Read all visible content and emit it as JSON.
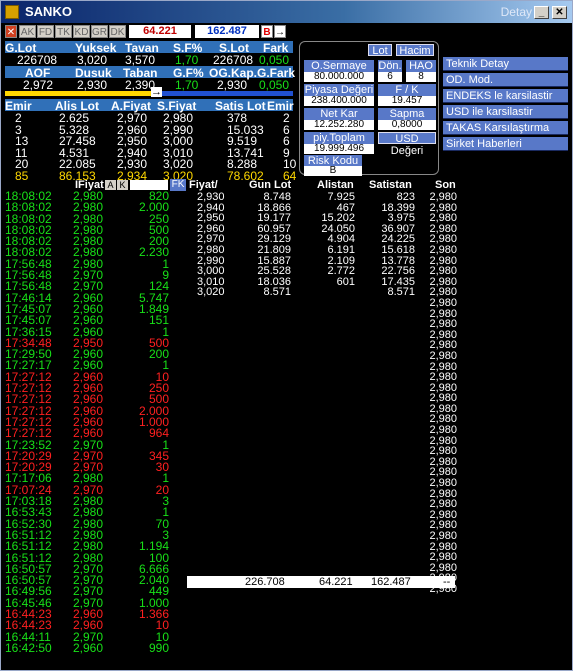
{
  "window": {
    "title": "SANKO",
    "detay": "Detay"
  },
  "toolbar": {
    "buttons": [
      "AK",
      "FD",
      "TK",
      "KD",
      "GR",
      "DK"
    ],
    "value1": "64.221",
    "value2": "162.487",
    "b_label": "B"
  },
  "summary": {
    "headers1": [
      "G.Lot",
      "Yuksek",
      "Tavan",
      "S.F%",
      "S.Lot",
      "Fark"
    ],
    "values1": [
      "226708",
      "3,020",
      "3,570",
      "1,70",
      "226708",
      "0,050"
    ],
    "headers2": [
      "AOF",
      "Dusuk",
      "Taban",
      "G.F%",
      "OG.Kap.",
      "G.Fark"
    ],
    "values2": [
      "2,972",
      "2,930",
      "2,390",
      "1,70",
      "2,930",
      "0,050"
    ]
  },
  "depth": {
    "headers": [
      "Emir",
      "Alis Lot",
      "A.Fiyat",
      "S.Fiyat",
      "Satis Lot",
      "Emir"
    ],
    "rows": [
      [
        "2",
        "2.625",
        "2,970",
        "2,980",
        "378",
        "2"
      ],
      [
        "3",
        "5.328",
        "2,960",
        "2,990",
        "15.033",
        "6"
      ],
      [
        "13",
        "27.458",
        "2,950",
        "3,000",
        "9.519",
        "6"
      ],
      [
        "11",
        "4.531",
        "2,940",
        "3,010",
        "13.741",
        "9"
      ],
      [
        "20",
        "22.085",
        "2,930",
        "3,020",
        "8.288",
        "10"
      ]
    ],
    "total": [
      "85",
      "86.153",
      "2,934",
      "3,020",
      "78.602",
      "64"
    ]
  },
  "info": {
    "lot_btn": "Lot",
    "hacim_btn": "Hacim",
    "osermaye_label": "O.Sermaye",
    "osermaye_value": "80.000.000",
    "don_label": "Dön.",
    "don_value": "6",
    "hao_label": "HAO",
    "hao_value": "8",
    "piyasa_label": "Piyasa Değeri",
    "piyasa_value": "238.400.000",
    "fk_label": "F / K",
    "fk_value": "19.457",
    "netkar_label": "Net Kar",
    "netkar_value": "12.252.280",
    "sapma_label": "Sapma",
    "sapma_value": "0,8000",
    "piytoplam_label": "piy.Toplam Lot",
    "piytoplam_value": "19.999.496",
    "usd_label": "USD Değeri",
    "risk_label": "Risk Kodu",
    "risk_value": "B"
  },
  "menu": [
    "Teknik Detay",
    "OD. Mod.",
    "ENDEKS le karsilastir",
    "USD ile karsilastir",
    "TAKAS Karsılaştırma",
    "Sirket Haberleri"
  ],
  "trades": {
    "header_fiyat": "IFiyat",
    "header_a": "A",
    "header_k": "K",
    "header_fk": "FK",
    "rows": [
      [
        "18:08:02",
        "2,980",
        "820",
        "g"
      ],
      [
        "18:08:02",
        "2,980",
        "2.000",
        "g"
      ],
      [
        "18:08:02",
        "2,980",
        "250",
        "g"
      ],
      [
        "18:08:02",
        "2,980",
        "500",
        "g"
      ],
      [
        "18:08:02",
        "2,980",
        "200",
        "g"
      ],
      [
        "18:08:02",
        "2,980",
        "2.230",
        "g"
      ],
      [
        "17:56:48",
        "2,980",
        "1",
        "g"
      ],
      [
        "17:56:48",
        "2,970",
        "9",
        "g"
      ],
      [
        "17:56:48",
        "2,970",
        "124",
        "g"
      ],
      [
        "17:46:14",
        "2,960",
        "5.747",
        "g"
      ],
      [
        "17:45:07",
        "2,960",
        "1.849",
        "g"
      ],
      [
        "17:45:07",
        "2,960",
        "151",
        "g"
      ],
      [
        "17:36:15",
        "2,960",
        "1",
        "g"
      ],
      [
        "17:34:48",
        "2,950",
        "500",
        "r"
      ],
      [
        "17:29:50",
        "2,960",
        "200",
        "g"
      ],
      [
        "17:27:17",
        "2,960",
        "1",
        "g"
      ],
      [
        "17:27:12",
        "2,960",
        "10",
        "r"
      ],
      [
        "17:27:12",
        "2,960",
        "250",
        "r"
      ],
      [
        "17:27:12",
        "2,960",
        "500",
        "r"
      ],
      [
        "17:27:12",
        "2,960",
        "2.000",
        "r"
      ],
      [
        "17:27:12",
        "2,960",
        "1.000",
        "r"
      ],
      [
        "17:27:12",
        "2,960",
        "964",
        "r"
      ],
      [
        "17:23:52",
        "2,970",
        "1",
        "g"
      ],
      [
        "17:20:29",
        "2,970",
        "345",
        "r"
      ],
      [
        "17:20:29",
        "2,970",
        "30",
        "r"
      ],
      [
        "17:17:06",
        "2,980",
        "1",
        "g"
      ],
      [
        "17:07:24",
        "2,970",
        "20",
        "r"
      ],
      [
        "17:03:18",
        "2,980",
        "3",
        "g"
      ],
      [
        "16:53:43",
        "2,980",
        "1",
        "g"
      ],
      [
        "16:52:30",
        "2,980",
        "70",
        "g"
      ],
      [
        "16:51:12",
        "2,980",
        "3",
        "g"
      ],
      [
        "16:51:12",
        "2,980",
        "1.194",
        "g"
      ],
      [
        "16:51:12",
        "2,980",
        "100",
        "g"
      ],
      [
        "16:50:57",
        "2,970",
        "6.666",
        "g"
      ],
      [
        "16:50:57",
        "2,970",
        "2.040",
        "g"
      ],
      [
        "16:49:56",
        "2,970",
        "449",
        "g"
      ],
      [
        "16:45:46",
        "2,970",
        "1.000",
        "g"
      ],
      [
        "16:44:23",
        "2,960",
        "1.366",
        "r"
      ],
      [
        "16:44:23",
        "2,960",
        "10",
        "r"
      ],
      [
        "16:44:11",
        "2,970",
        "10",
        "g"
      ],
      [
        "16:42:50",
        "2,960",
        "990",
        "g"
      ]
    ]
  },
  "prices": {
    "headers": [
      "Fiyat/",
      "Gun Lot",
      "Alistan",
      "Satistan",
      "Son"
    ],
    "rows": [
      [
        "2,930",
        "8.748",
        "7.925",
        "823"
      ],
      [
        "2,940",
        "18.866",
        "467",
        "18.399"
      ],
      [
        "2,950",
        "19.177",
        "15.202",
        "3.975"
      ],
      [
        "2,960",
        "60.957",
        "24.050",
        "36.907"
      ],
      [
        "2,970",
        "29.129",
        "4.904",
        "24.225"
      ],
      [
        "2,980",
        "21.809",
        "6.191",
        "15.618"
      ],
      [
        "2,990",
        "15.887",
        "2.109",
        "13.778"
      ],
      [
        "3,000",
        "25.528",
        "2.772",
        "22.756"
      ],
      [
        "3,010",
        "18.036",
        "601",
        "17.435"
      ],
      [
        "3,020",
        "8.571",
        "",
        "8.571"
      ]
    ],
    "son": [
      "2,980",
      "2,980",
      "2,980",
      "2,980",
      "2,980",
      "2,980",
      "2,980",
      "2,980",
      "2,980",
      "2,980",
      "2,980",
      "2,980",
      "2,980",
      "2,980",
      "2,980",
      "2,980",
      "2,980",
      "2,980",
      "2,980",
      "2,980",
      "2,980",
      "2,980",
      "2,980",
      "2,980",
      "2,980",
      "2,980",
      "2,980",
      "2,980",
      "2,980",
      "2,980",
      "2,980",
      "2,980",
      "2,980",
      "2,980",
      "2,980",
      "2,980",
      "2,980",
      "2,980"
    ],
    "totals": [
      "226.708",
      "64.221",
      "162.487",
      "--"
    ]
  }
}
